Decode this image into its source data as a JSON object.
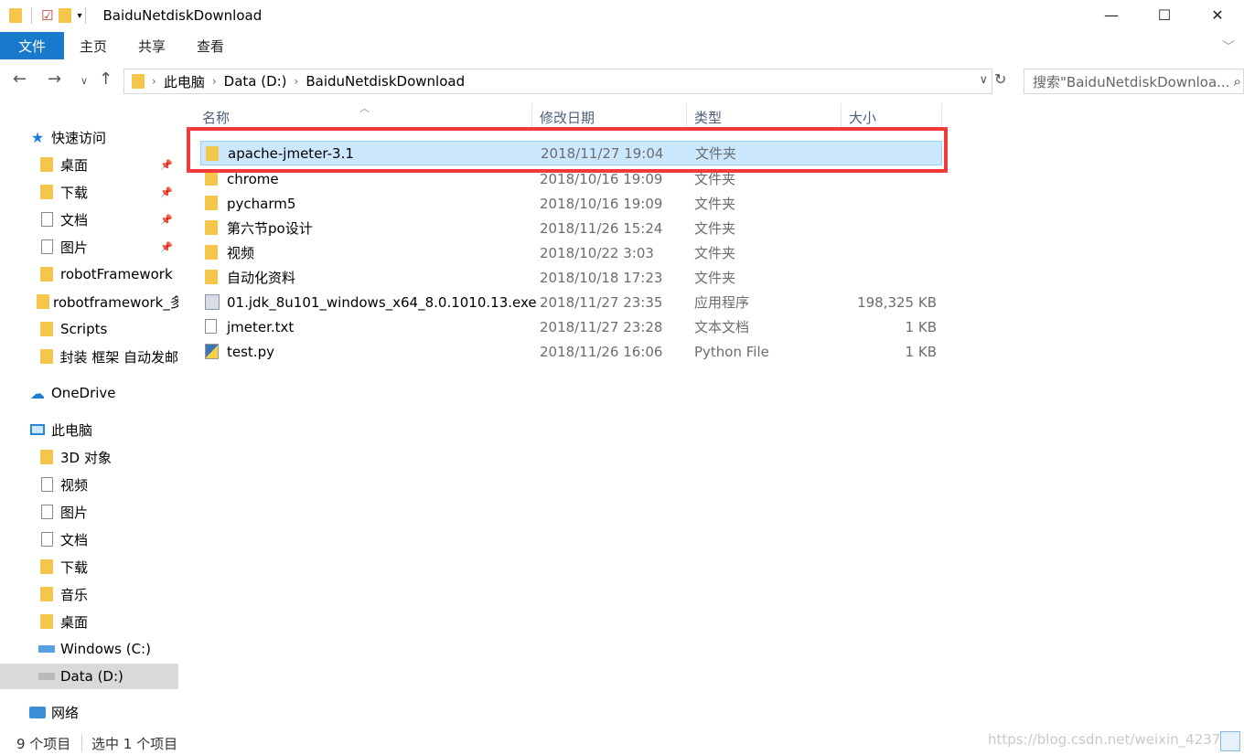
{
  "window": {
    "title": "BaiduNetdiskDownload"
  },
  "ribbon": {
    "tabs": [
      "文件",
      "主页",
      "共享",
      "查看"
    ]
  },
  "address": {
    "crumbs": [
      "此电脑",
      "Data (D:)",
      "BaiduNetdiskDownload"
    ],
    "search_placeholder": "搜索\"BaiduNetdiskDownloa..."
  },
  "nav": {
    "quick_access": "快速访问",
    "quick_items": [
      "桌面",
      "下载",
      "文档",
      "图片",
      "robotFramework",
      "robotframework_多",
      "Scripts",
      "封装 框架 自动发邮"
    ],
    "onedrive": "OneDrive",
    "this_pc": "此电脑",
    "pc_items": [
      "3D 对象",
      "视频",
      "图片",
      "文档",
      "下载",
      "音乐",
      "桌面",
      "Windows (C:)",
      "Data (D:)"
    ],
    "network": "网络"
  },
  "columns": {
    "name": "名称",
    "date": "修改日期",
    "type": "类型",
    "size": "大小"
  },
  "files": [
    {
      "name": "apache-jmeter-3.1",
      "date": "2018/11/27 19:04",
      "type": "文件夹",
      "size": "",
      "icon": "folder-icon"
    },
    {
      "name": "chrome",
      "date": "2018/10/16 19:09",
      "type": "文件夹",
      "size": "",
      "icon": "folder-icon"
    },
    {
      "name": "pycharm5",
      "date": "2018/10/16 19:09",
      "type": "文件夹",
      "size": "",
      "icon": "folder-icon"
    },
    {
      "name": "第六节po设计",
      "date": "2018/11/26 15:24",
      "type": "文件夹",
      "size": "",
      "icon": "folder-icon"
    },
    {
      "name": "视频",
      "date": "2018/10/22 3:03",
      "type": "文件夹",
      "size": "",
      "icon": "folder-icon"
    },
    {
      "name": "自动化资料",
      "date": "2018/10/18 17:23",
      "type": "文件夹",
      "size": "",
      "icon": "folder-icon"
    },
    {
      "name": "01.jdk_8u101_windows_x64_8.0.1010.13.exe",
      "date": "2018/11/27 23:35",
      "type": "应用程序",
      "size": "198,325 KB",
      "icon": "exe-icon"
    },
    {
      "name": "jmeter.txt",
      "date": "2018/11/27 23:28",
      "type": "文本文档",
      "size": "1 KB",
      "icon": "text-file-icon"
    },
    {
      "name": "test.py",
      "date": "2018/11/26 16:06",
      "type": "Python File",
      "size": "1 KB",
      "icon": "python-file-icon"
    }
  ],
  "status": {
    "count": "9 个项目",
    "selected": "选中 1 个项目",
    "watermark": "https://blog.csdn.net/weixin_4237"
  },
  "colors": {
    "accent": "#1979ca",
    "selection": "#cce8ff",
    "highlight_box": "#f23a3a"
  }
}
